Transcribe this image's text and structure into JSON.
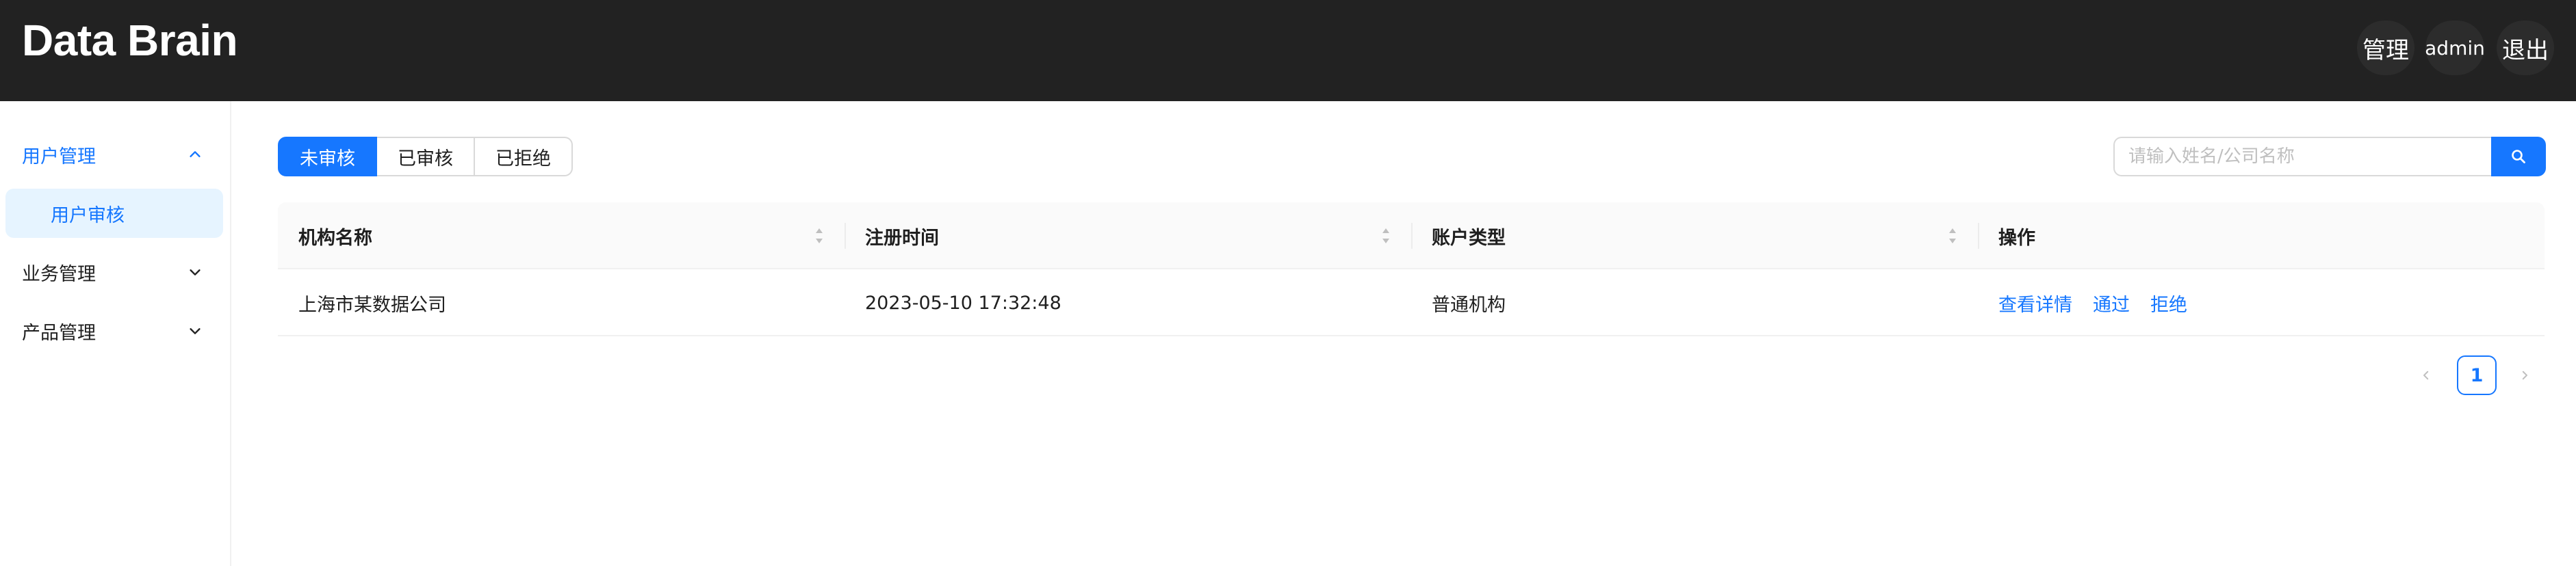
{
  "header": {
    "logo": "Data Brain",
    "manage_label": "管理",
    "user_label": "admin",
    "logout_label": "退出",
    "background": "#222222"
  },
  "sidebar": {
    "items": [
      {
        "label": "用户管理",
        "expanded": true,
        "icon": "chevron-up-icon"
      },
      {
        "label": "用户审核",
        "selected": true
      },
      {
        "label": "业务管理",
        "expanded": false,
        "icon": "chevron-down-icon"
      },
      {
        "label": "产品管理",
        "expanded": false,
        "icon": "chevron-down-icon"
      }
    ]
  },
  "tabs": [
    {
      "label": "未审核",
      "active": true
    },
    {
      "label": "已审核",
      "active": false
    },
    {
      "label": "已拒绝",
      "active": false
    }
  ],
  "search": {
    "placeholder": "请输入姓名/公司名称",
    "value": "",
    "icon": "search-icon"
  },
  "table": {
    "columns": [
      "机构名称",
      "注册时间",
      "账户类型",
      "操作"
    ],
    "rows": [
      {
        "name": "上海市某数据公司",
        "registered": "2023-05-10 17:32:48",
        "account_type": "普通机构",
        "actions": [
          "查看详情",
          "通过",
          "拒绝"
        ]
      }
    ]
  },
  "pagination": {
    "current": "1"
  },
  "colors": {
    "primary": "#1677ff",
    "header_bg": "#222222",
    "selected_bg": "#e6f4ff"
  }
}
